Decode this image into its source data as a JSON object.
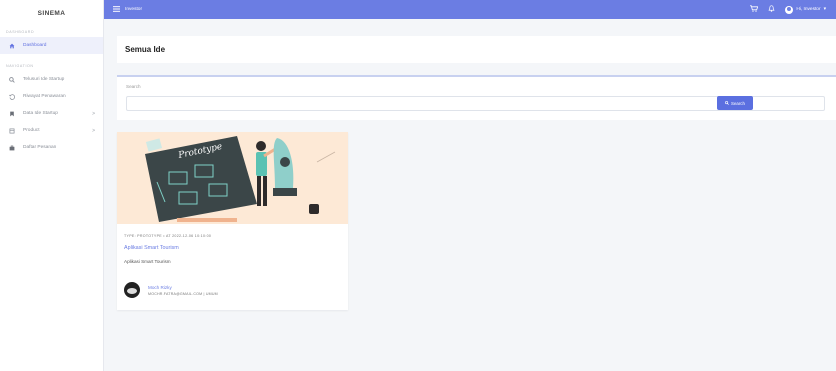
{
  "sidebar": {
    "brand": "SINEMA",
    "section_dashboard": "DASHBOARD",
    "section_navigation": "NAVIGATION",
    "items": [
      {
        "label": "Dashboard",
        "icon": "home-icon",
        "active": true
      },
      {
        "label": "Telusuri Ide Startup",
        "icon": "search-icon"
      },
      {
        "label": "Riwayat Penawaran",
        "icon": "history-icon"
      },
      {
        "label": "Data Ide Startup",
        "icon": "bookmark-icon",
        "arrow": ">"
      },
      {
        "label": "Product",
        "icon": "box-icon",
        "arrow": ">"
      },
      {
        "label": "Daftar Pesanan",
        "icon": "briefcase-icon"
      }
    ]
  },
  "topbar": {
    "role": "Investor",
    "greeting": "Hi, Investor",
    "accent_color": "#6b7de3"
  },
  "page": {
    "title": "Semua Ide"
  },
  "search": {
    "label": "Search",
    "placeholder": "",
    "button_label": "Search"
  },
  "cards": [
    {
      "image_text": "Prototype",
      "meta": "TYPE: PROTOTYPE • AT 2022-12-06 10:10:00",
      "title": "Aplikasi Smart Tourism",
      "description": "Aplikasi Smart Tourism",
      "author_name": "Moch Rizky",
      "author_email": "MOCHR.FATRA@GMAIL.COM | UMUM"
    }
  ]
}
